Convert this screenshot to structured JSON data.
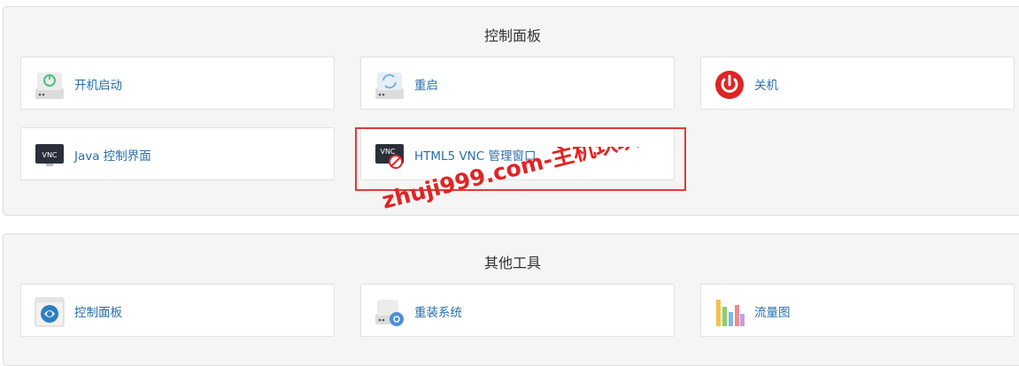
{
  "control_panel": {
    "title": "控制面板",
    "tiles": [
      {
        "label": "开机启动",
        "icon": "power-on-drive-icon"
      },
      {
        "label": "重启",
        "icon": "restart-drive-icon"
      },
      {
        "label": "关机",
        "icon": "power-off-icon"
      },
      {
        "label": "Java 控制界面",
        "icon": "vnc-monitor-icon"
      },
      {
        "label": "HTML5 VNC 管理窗口",
        "icon": "vnc-disabled-icon"
      }
    ]
  },
  "other_tools": {
    "title": "其他工具",
    "tiles": [
      {
        "label": "控制面板",
        "icon": "control-panel-app-icon"
      },
      {
        "label": "重装系统",
        "icon": "reinstall-drive-icon"
      },
      {
        "label": "流量图",
        "icon": "bar-chart-icon"
      }
    ]
  },
  "watermark": {
    "text": "zhuji999.com-主机玖玖"
  },
  "colors": {
    "panel_bg": "#f5f5f5",
    "link": "#2a6ea8",
    "highlight": "#e03a3a",
    "power_off": "#e02424"
  }
}
